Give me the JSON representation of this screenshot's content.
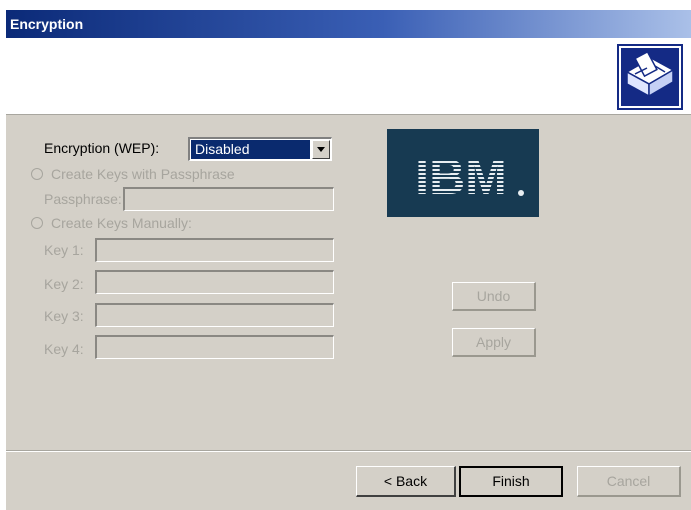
{
  "window": {
    "title": "Encryption"
  },
  "icons": {
    "header_icon": "wizard-network-card-icon"
  },
  "encryption": {
    "label": "Encryption (WEP):",
    "selected": "Disabled"
  },
  "passphrase_option": {
    "label": "Create Keys with Passphrase",
    "field_label": "Passphrase:",
    "value": ""
  },
  "manual_option": {
    "label": "Create Keys Manually:",
    "keys": [
      {
        "label": "Key 1:",
        "value": ""
      },
      {
        "label": "Key 2:",
        "value": ""
      },
      {
        "label": "Key 3:",
        "value": ""
      },
      {
        "label": "Key 4:",
        "value": ""
      }
    ]
  },
  "logo": {
    "text": "IBM"
  },
  "buttons": {
    "undo": "Undo",
    "apply": "Apply",
    "back": "< Back",
    "finish": "Finish",
    "cancel": "Cancel"
  },
  "colors": {
    "title_bar": "#0b2a78",
    "dialog_bg": "#d4d0c8",
    "select_highlight": "#0a2a6e",
    "logo_bg": "#173a52",
    "disabled_text": "#a7a59e"
  }
}
